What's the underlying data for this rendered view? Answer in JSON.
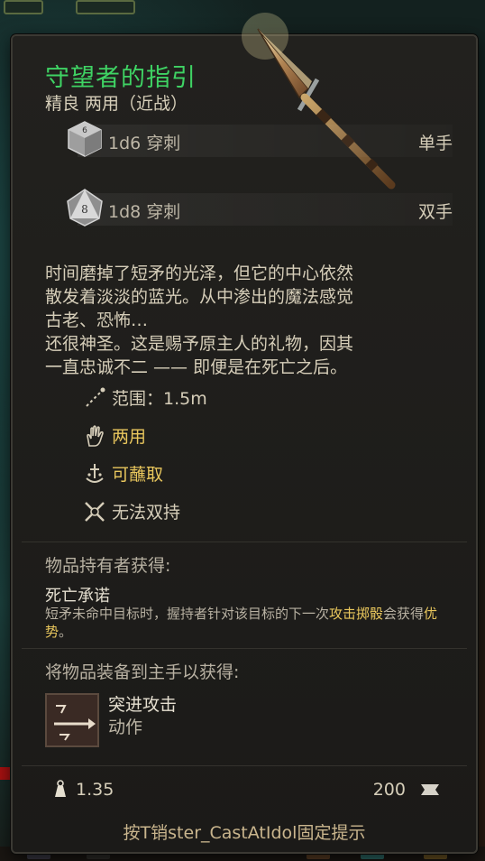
{
  "item": {
    "name": "守望者的指引",
    "subtitle": "精良 两用（近战）",
    "damage": [
      {
        "value": "1d6 穿刺",
        "hand": "单手",
        "die": "d6"
      },
      {
        "value": "1d8 穿刺",
        "hand": "双手",
        "die": "8"
      }
    ],
    "description": [
      "时间磨掉了短矛的光泽，但它的中心依然",
      "散发着淡淡的蓝光。从中渗出的魔法感觉",
      "古老、恐怖…",
      "还很神圣。这是赐予原主人的礼物，因其",
      "一直忠诚不二 —— 即便是在死亡之后。"
    ],
    "properties": [
      {
        "icon": "range-icon",
        "text": "范围：1.5m",
        "style": "white"
      },
      {
        "icon": "hand-icon",
        "text": "两用",
        "style": "gold"
      },
      {
        "icon": "dip-icon",
        "text": "可蘸取",
        "style": "gold"
      },
      {
        "icon": "no-dual-wield-icon",
        "text": "无法双持",
        "style": "white"
      }
    ],
    "holder_section": {
      "heading": "物品持有者获得:",
      "ench_name": "死亡承诺",
      "ench_desc_prefix": "短矛未命中目标时，握持者针对该目标的下一次",
      "ench_desc_link1": "攻击掷骰",
      "ench_desc_mid": "会获得",
      "ench_desc_link2": "优势",
      "ench_desc_suffix": "。"
    },
    "equip_section": {
      "heading": "将物品装备到主手以获得:",
      "action_name": "突进攻击",
      "action_type": "动作"
    },
    "weight": "1.35",
    "value": "200",
    "hint": "按T销ster_CastAtIdol固定提示"
  },
  "colors": {
    "title": "#3fd364",
    "gold": "#e9c75d"
  }
}
